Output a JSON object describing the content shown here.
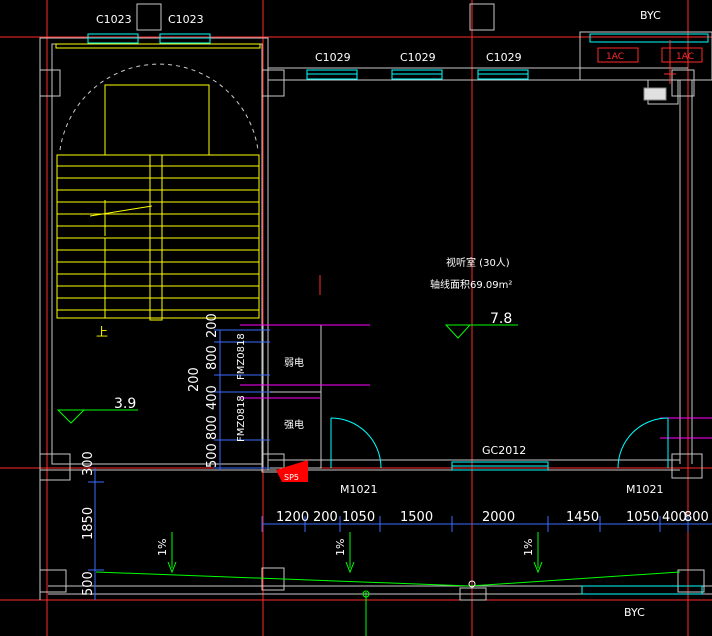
{
  "window_labels": {
    "c1023_a": "C1023",
    "c1023_b": "C1023",
    "c1029_a": "C1029",
    "c1029_b": "C1029",
    "c1029_c": "C1029",
    "gc2012": "GC2012",
    "byc_top": "BYC",
    "byc_bottom": "BYC"
  },
  "room": {
    "name": "视听室   (30人)",
    "area": "轴线面积69.09m²"
  },
  "elevations": {
    "room": "7.8",
    "stair_landing": "3.9"
  },
  "doors": {
    "m1021_left": "M1021",
    "m1021_right": "M1021",
    "fm_upper": "FMZ0818",
    "fm_lower": "FMZ0818"
  },
  "shafts": {
    "upper": "弱电",
    "lower": "强电"
  },
  "stair_label": "上",
  "ac_labels": [
    "1AC",
    "1AC"
  ],
  "red_tag": "SP5",
  "dimensions": {
    "horizontal": [
      "1200",
      "200",
      "1050",
      "1500",
      "2000",
      "1450",
      "1050",
      "400",
      "800"
    ],
    "vertical_left": [
      "300",
      "1850",
      "500"
    ],
    "vertical_shaft": [
      "200",
      "800",
      "400",
      "200",
      "800",
      "500"
    ]
  },
  "slopes": [
    "1%",
    "1%",
    "1%"
  ],
  "colors": {
    "background": "#000000",
    "axis": "#ff2a2a",
    "wall": "#c8c8c8",
    "stair": "#ffff00",
    "dimension": "#3a6cff",
    "window": "#00ffff",
    "text": "#ffffff",
    "door": "#00ffff",
    "slope": "#00ff00",
    "magenta": "#ff00ff"
  }
}
